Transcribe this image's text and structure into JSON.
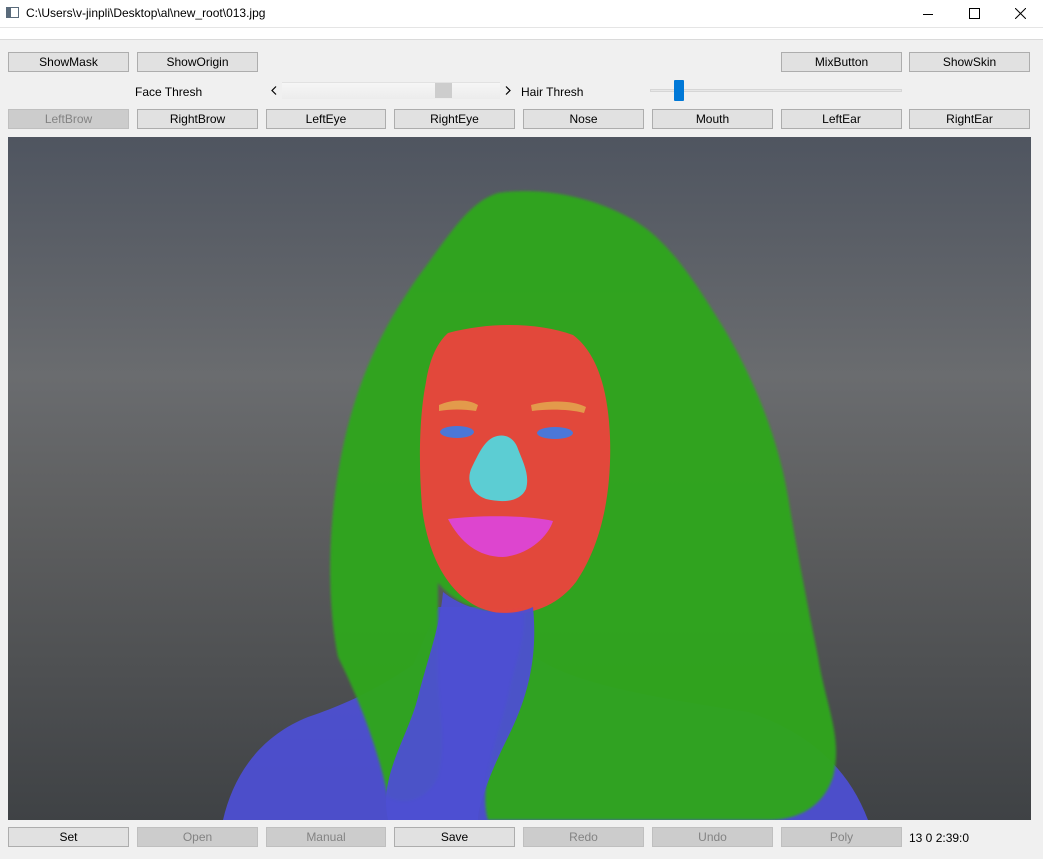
{
  "window": {
    "title": "C:\\Users\\v-jinpli\\Desktop\\al\\new_root\\013.jpg"
  },
  "top_buttons": {
    "show_mask": "ShowMask",
    "show_origin": "ShowOrigin",
    "mix_button": "MixButton",
    "show_skin": "ShowSkin"
  },
  "controls": {
    "face_thresh_label": "Face Thresh",
    "hair_thresh_label": "Hair Thresh",
    "face_thresh_value": 0.76,
    "hair_thresh_value": 0.1
  },
  "part_buttons": [
    {
      "label": "LeftBrow",
      "enabled": false
    },
    {
      "label": "RightBrow",
      "enabled": true
    },
    {
      "label": "LeftEye",
      "enabled": true
    },
    {
      "label": "RightEye",
      "enabled": true
    },
    {
      "label": "Nose",
      "enabled": true
    },
    {
      "label": "Mouth",
      "enabled": true
    },
    {
      "label": "LeftEar",
      "enabled": true
    },
    {
      "label": "RightEar",
      "enabled": true
    }
  ],
  "bottom_buttons": [
    {
      "label": "Set",
      "enabled": true
    },
    {
      "label": "Open",
      "enabled": false
    },
    {
      "label": "Manual",
      "enabled": false
    },
    {
      "label": "Save",
      "enabled": true
    },
    {
      "label": "Redo",
      "enabled": false
    },
    {
      "label": "Undo",
      "enabled": false
    },
    {
      "label": "Poly",
      "enabled": false
    }
  ],
  "status_text": "13  0  2:39:0",
  "colors": {
    "hair_mask": "#2fa51f",
    "face_mask": "#e8453c",
    "body_mask": "#4d4fd2",
    "nose_mask": "#5ccdd3",
    "mouth_mask": "#dd45cf",
    "brow_mask": "#e39a4b",
    "eye_mask": "#4b77d8",
    "slider_accent": "#0078d7"
  }
}
